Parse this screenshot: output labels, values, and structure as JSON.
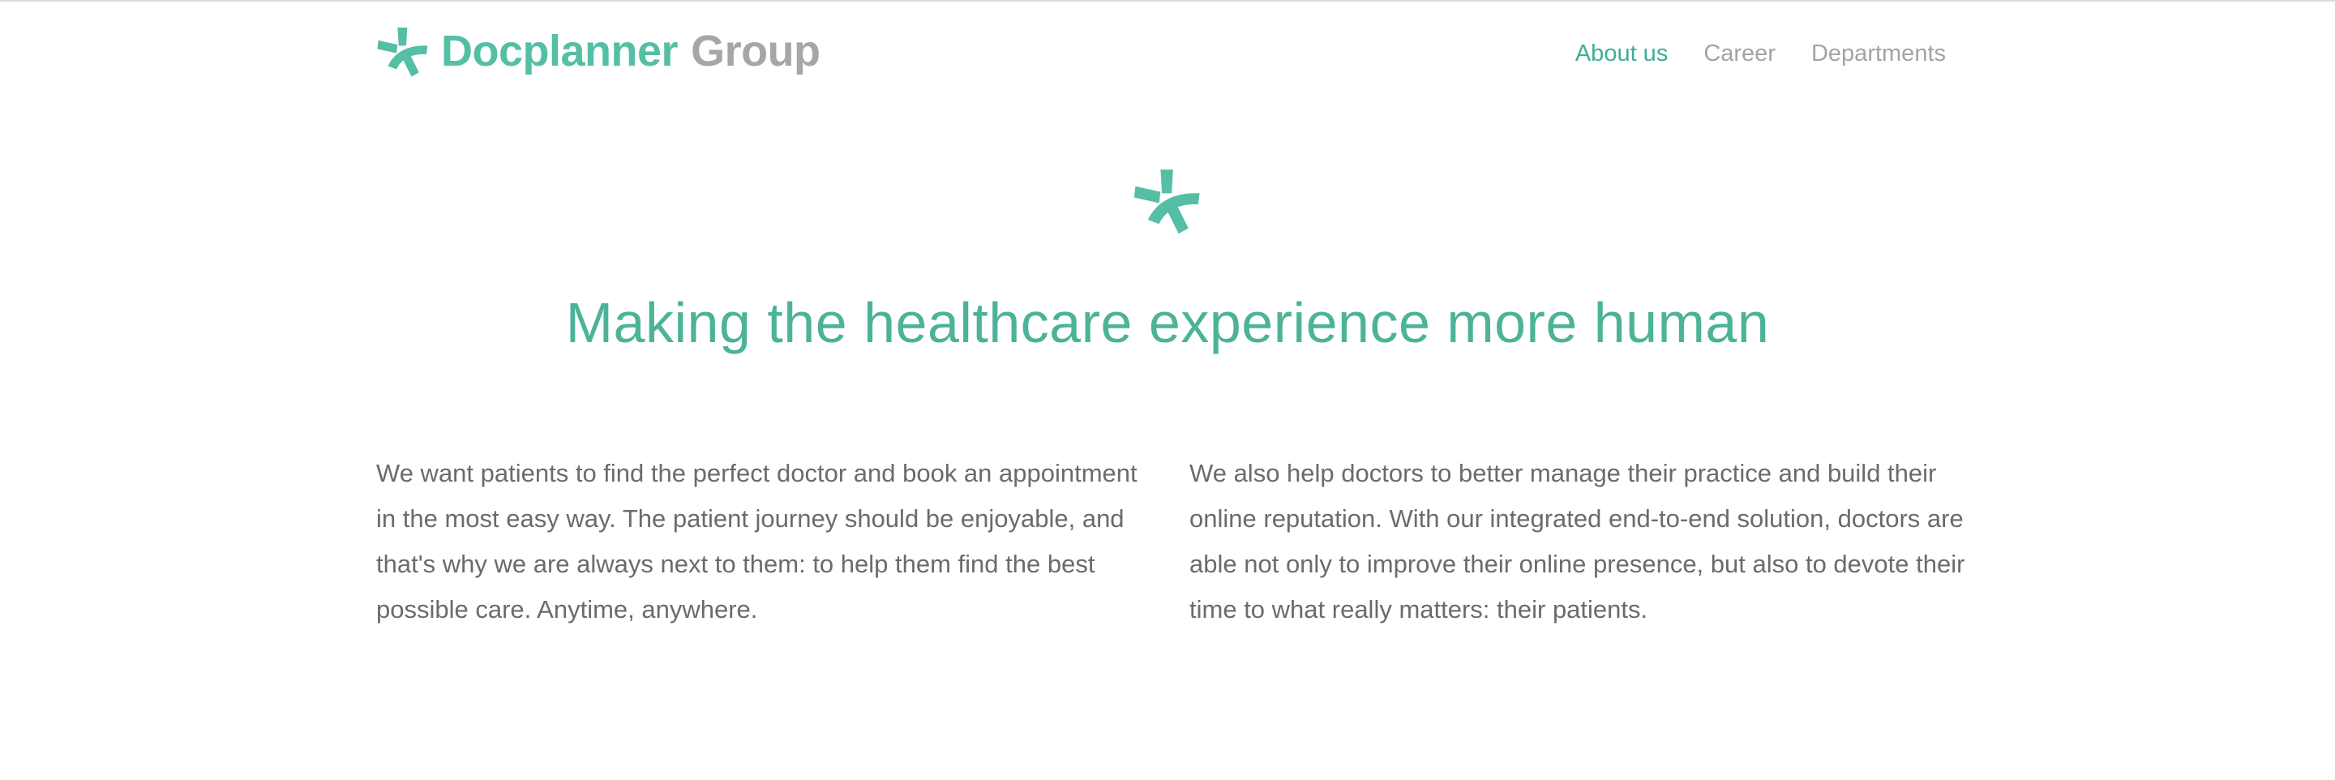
{
  "brand": {
    "name_primary": "Docplanner",
    "name_secondary": "Group",
    "accent_color": "#55bfa5",
    "muted_color": "#a6a6a6",
    "logo_icon": "star-cross-icon"
  },
  "nav": {
    "items": [
      {
        "label": "About us",
        "active": true
      },
      {
        "label": "Career",
        "active": false
      },
      {
        "label": "Departments",
        "active": false
      }
    ]
  },
  "hero": {
    "icon": "star-cross-icon",
    "title": "Making the healthcare experience more human"
  },
  "content": {
    "left_paragraph": "We want patients to find the perfect doctor and book an appointment in the most easy way. The patient journey should be enjoyable, and that's why we are always next to them: to help them find the best possible care. Anytime, anywhere.",
    "right_paragraph": "We also help doctors to better manage their practice and build their online reputation. With our integrated end-to-end solution, doctors are able not only to improve their online presence, but also to devote their time to what really matters: their patients."
  }
}
